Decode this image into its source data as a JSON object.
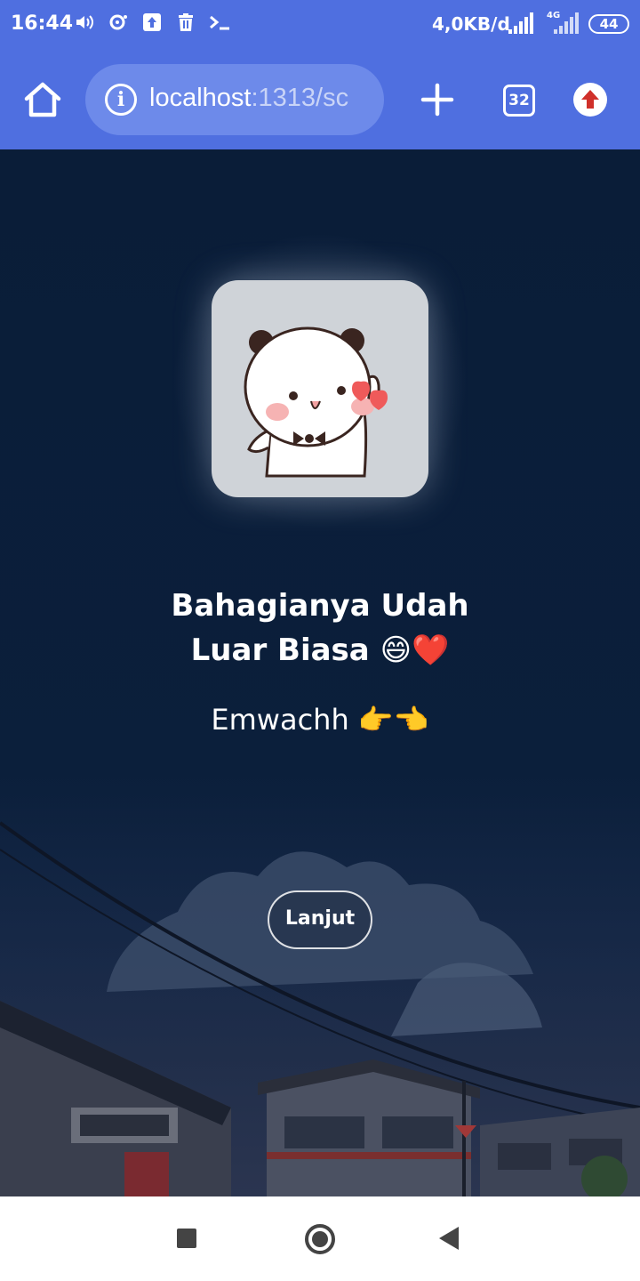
{
  "status_bar": {
    "time": "16:44",
    "network_speed": "4,0KB/d",
    "network_type": "4G",
    "battery": "44"
  },
  "browser": {
    "url_host": "localhost",
    "url_rest": ":1313/sc",
    "tab_count": "32"
  },
  "content": {
    "headline_line1": "Bahagianya Udah",
    "headline_line2": "Luar Biasa 😄❤️",
    "subline": "Emwachh 👉👈",
    "next_button": "Lanjut"
  },
  "colors": {
    "toolbar": "#4f6fe0",
    "page_background": "#0b1f3a",
    "sticker_card": "#cfd3d8"
  }
}
